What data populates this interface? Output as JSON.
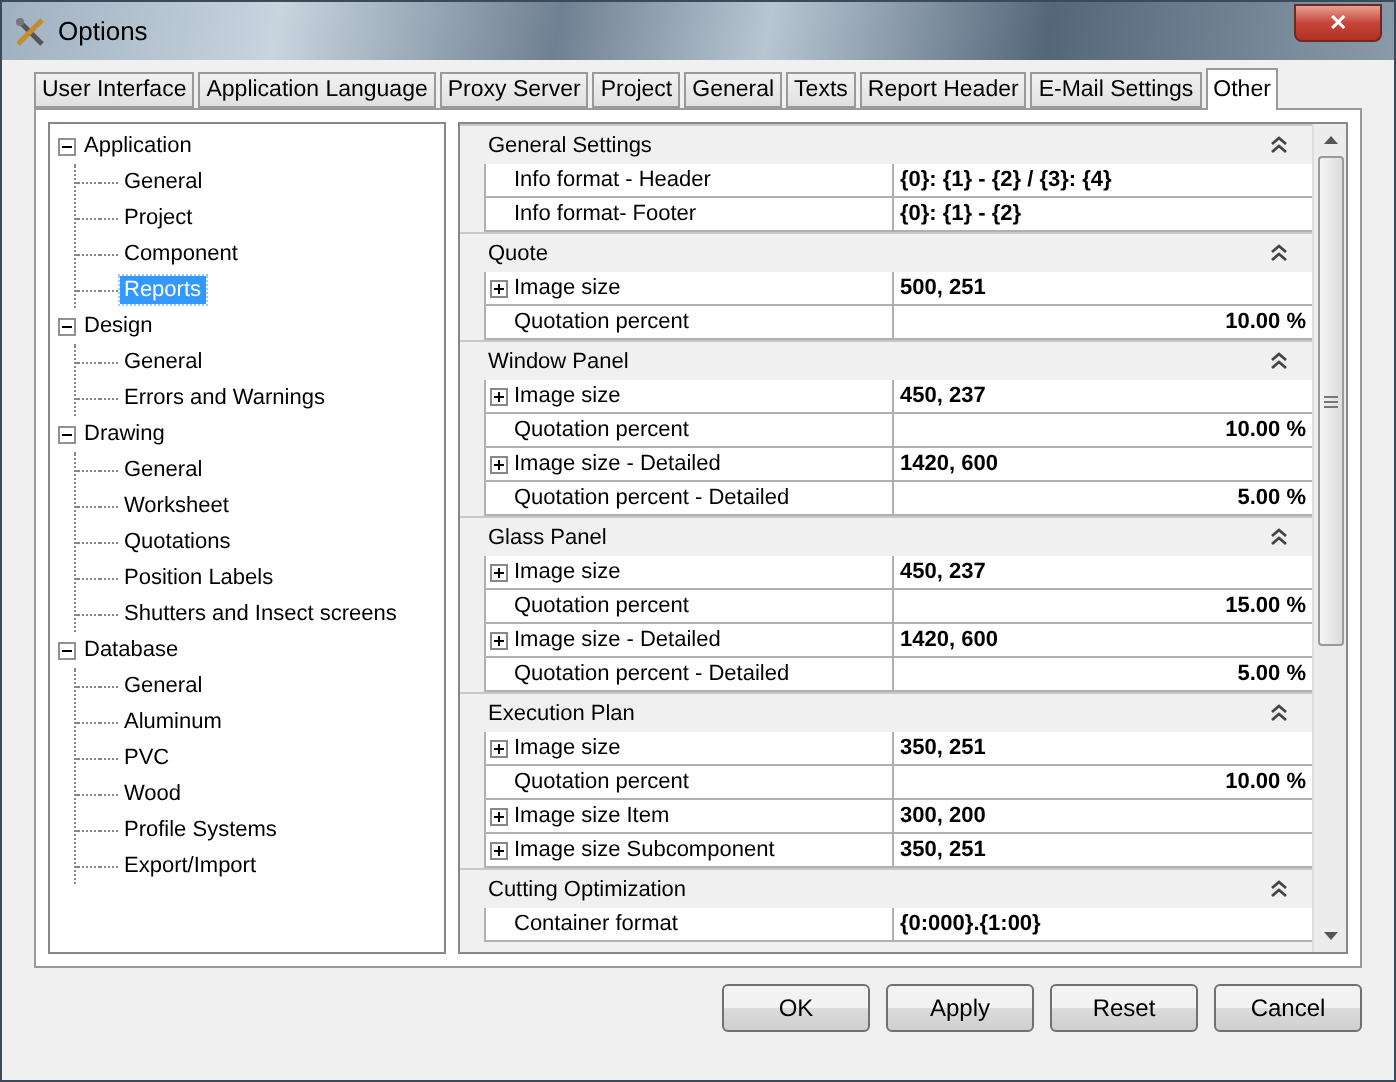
{
  "window": {
    "title": "Options",
    "close": "✕"
  },
  "tabs": [
    {
      "label": "User Interface",
      "selected": false
    },
    {
      "label": "Application Language",
      "selected": false
    },
    {
      "label": "Proxy Server",
      "selected": false
    },
    {
      "label": "Project",
      "selected": false
    },
    {
      "label": "General",
      "selected": false
    },
    {
      "label": "Texts",
      "selected": false
    },
    {
      "label": "Report Header",
      "selected": false
    },
    {
      "label": "E-Mail Settings",
      "selected": false
    },
    {
      "label": "Other",
      "selected": true
    }
  ],
  "tree": [
    {
      "label": "Application",
      "expanded": true,
      "selected": false,
      "children": [
        {
          "label": "General",
          "selected": false
        },
        {
          "label": "Project",
          "selected": false
        },
        {
          "label": "Component",
          "selected": false
        },
        {
          "label": "Reports",
          "selected": true
        }
      ]
    },
    {
      "label": "Design",
      "expanded": true,
      "selected": false,
      "children": [
        {
          "label": "General",
          "selected": false
        },
        {
          "label": "Errors and Warnings",
          "selected": false
        }
      ]
    },
    {
      "label": "Drawing",
      "expanded": true,
      "selected": false,
      "children": [
        {
          "label": "General",
          "selected": false
        },
        {
          "label": "Worksheet",
          "selected": false
        },
        {
          "label": "Quotations",
          "selected": false
        },
        {
          "label": "Position Labels",
          "selected": false
        },
        {
          "label": "Shutters and Insect screens",
          "selected": false
        }
      ]
    },
    {
      "label": "Database",
      "expanded": true,
      "selected": false,
      "children": [
        {
          "label": "General",
          "selected": false
        },
        {
          "label": "Aluminum",
          "selected": false
        },
        {
          "label": "PVC",
          "selected": false
        },
        {
          "label": "Wood",
          "selected": false
        },
        {
          "label": "Profile Systems",
          "selected": false
        },
        {
          "label": "Export/Import",
          "selected": false
        }
      ]
    }
  ],
  "property_grid": [
    {
      "title": "General Settings",
      "expanded": true,
      "rows": [
        {
          "label": "Info format - Header",
          "value": "{0}: {1} - {2} / {3}: {4}",
          "kind": "text",
          "expandable": false
        },
        {
          "label": "Info format- Footer",
          "value": "{0}: {1} - {2}",
          "kind": "text",
          "expandable": false
        }
      ]
    },
    {
      "title": "Quote",
      "expanded": true,
      "rows": [
        {
          "label": "Image size",
          "value": "500, 251",
          "kind": "text",
          "expandable": true
        },
        {
          "label": "Quotation percent",
          "value": "10.00 %",
          "kind": "percent",
          "expandable": false
        }
      ]
    },
    {
      "title": "Window Panel",
      "expanded": true,
      "rows": [
        {
          "label": "Image size",
          "value": "450, 237",
          "kind": "text",
          "expandable": true
        },
        {
          "label": "Quotation percent",
          "value": "10.00 %",
          "kind": "percent",
          "expandable": false
        },
        {
          "label": "Image size - Detailed",
          "value": "1420, 600",
          "kind": "text",
          "expandable": true
        },
        {
          "label": "Quotation percent - Detailed",
          "value": "5.00 %",
          "kind": "percent",
          "expandable": false
        }
      ]
    },
    {
      "title": "Glass Panel",
      "expanded": true,
      "rows": [
        {
          "label": "Image size",
          "value": "450, 237",
          "kind": "text",
          "expandable": true
        },
        {
          "label": "Quotation percent",
          "value": "15.00 %",
          "kind": "percent",
          "expandable": false
        },
        {
          "label": "Image size - Detailed",
          "value": "1420, 600",
          "kind": "text",
          "expandable": true
        },
        {
          "label": "Quotation percent  - Detailed",
          "value": "5.00 %",
          "kind": "percent",
          "expandable": false
        }
      ]
    },
    {
      "title": "Execution Plan",
      "expanded": true,
      "rows": [
        {
          "label": "Image size",
          "value": "350, 251",
          "kind": "text",
          "expandable": true
        },
        {
          "label": "Quotation percent",
          "value": "10.00 %",
          "kind": "percent",
          "expandable": false
        },
        {
          "label": "Image size Item",
          "value": "300, 200",
          "kind": "text",
          "expandable": true
        },
        {
          "label": "Image size Subcomponent",
          "value": "350, 251",
          "kind": "text",
          "expandable": true
        }
      ]
    },
    {
      "title": "Cutting Optimization",
      "expanded": true,
      "rows": [
        {
          "label": "Container format",
          "value": "{0:000}.{1:00}",
          "kind": "text",
          "expandable": false
        }
      ]
    }
  ],
  "buttons": [
    "OK",
    "Apply",
    "Reset",
    "Cancel"
  ]
}
